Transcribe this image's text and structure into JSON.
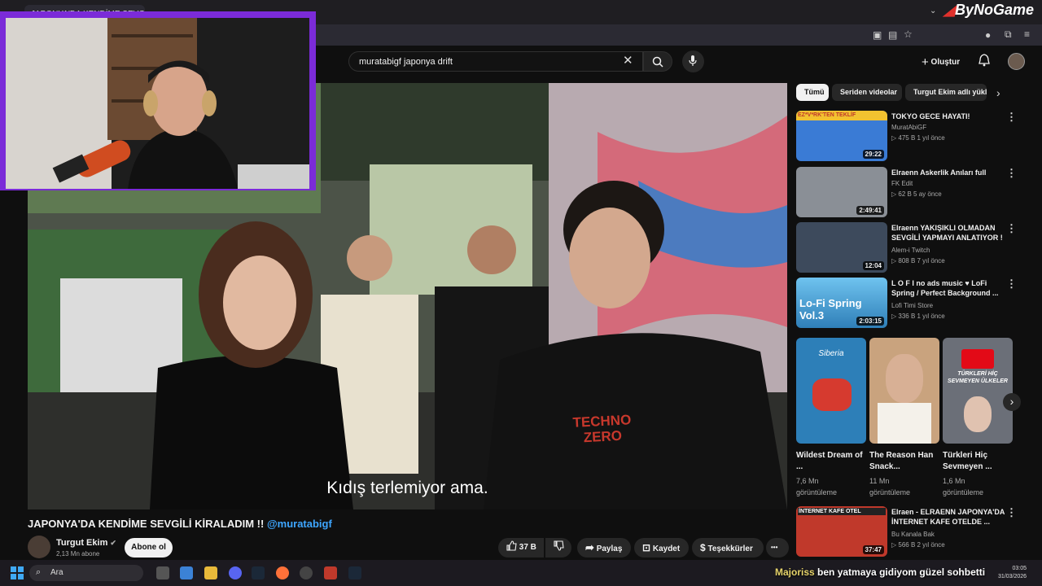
{
  "browser": {
    "tab_title": "JAPONYA'DA KENDİME SEVGİLİ",
    "brand_by": "By",
    "brand_name": "NoGame"
  },
  "header": {
    "search_value": "muratabigf japonya drift",
    "create_label": "Oluştur"
  },
  "video": {
    "subtitle": "Kıdış terlemiyor ama.",
    "title": "JAPONYA'DA KENDİME SEVGİLİ KİRALADIM !!",
    "title_mention": "@muratabigf",
    "shirt_text_1": "TECHNO",
    "shirt_text_2": "ZERO"
  },
  "channel": {
    "name": "Turgut Ekim",
    "subscribers": "2,13 Mn abone",
    "subscribe_label": "Abone ol"
  },
  "actions": {
    "like_count": "37 B",
    "share_label": "Paylaş",
    "save_label": "Kaydet",
    "thanks_label": "Teşekkürler",
    "more_label": "•••"
  },
  "chips": [
    "Tümü",
    "Seriden videolar",
    "Turgut Ekim adlı yükle"
  ],
  "recommendations": [
    {
      "title": "TOKYO GECE HAYATI!",
      "channel": "MuratAbiGF",
      "meta": "▷ 475 B  1 yıl önce",
      "duration": "29:22",
      "thumb_text": "EZ*V*RK'TEN TEKLİF",
      "color": "#3a7bd5"
    },
    {
      "title": "Elraenn Askerlik Anıları full",
      "channel": "FK Edit",
      "meta": "▷ 62 B  5 ay önce",
      "duration": "2:49:41",
      "thumb_text": "",
      "color": "#8a8f96"
    },
    {
      "title": "Elraenn YAKIŞIKLI OLMADAN SEVGİLİ YAPMAYI ANLATIYOR !",
      "channel": "Alem-i Twitch",
      "meta": "▷ 808 B  7 yıl önce",
      "duration": "12:04",
      "thumb_text": "",
      "color": "#3d4a5c"
    },
    {
      "title": "L O F I no ads music ♥ LoFi Spring / Perfect Background ...",
      "channel": "Lofi Timi Store",
      "meta": "▷ 336 B  1 yıl önce",
      "duration": "2:03:15",
      "thumb_text": "Lo-Fi Spring Vol.3",
      "color": "#4aa3d8"
    },
    {
      "title": "Elraen - ELRAENN JAPONYA'DA İNTERNET KAFE OTELDE ...",
      "channel": "Bu Kanala Bak",
      "meta": "▷ 566 B  2 yıl önce",
      "duration": "37:47",
      "thumb_text": "İNTERNET KAFE OTEL",
      "color": "#c0392b"
    }
  ],
  "shorts": [
    {
      "title": "Wildest Dream of ...",
      "views": "7,6 Mn",
      "views_label": "görüntüleme",
      "thumb_text": "Siberia",
      "color": "#2d7fb8"
    },
    {
      "title": "The Reason Han Snack...",
      "views": "11 Mn",
      "views_label": "görüntüleme",
      "thumb_text": "",
      "color": "#c9a37e"
    },
    {
      "title": "Türkleri Hiç Sevmeyen ...",
      "views": "1,6 Mn",
      "views_label": "görüntüleme",
      "thumb_text": "TÜRKLERİ HİÇ SEVMEYEN ÜLKELER",
      "color": "#6b6f78"
    }
  ],
  "taskbar": {
    "search_placeholder": "Ara",
    "chat_user": "Majoriss",
    "chat_message": "ben yatmaya gidiyom güzel sohbetti",
    "time": "03:05",
    "date": "31/03/2026"
  },
  "colors": {
    "accent_blue": "#3ea6ff",
    "webcam_border": "#7b2bd8",
    "brand_red": "#e0312c"
  },
  "icons": [
    "search-icon",
    "mic-icon",
    "bell-icon",
    "plus-icon",
    "like-icon",
    "dislike-icon",
    "share-icon",
    "save-icon",
    "thanks-icon",
    "chevron-right-icon",
    "windows-icon"
  ]
}
